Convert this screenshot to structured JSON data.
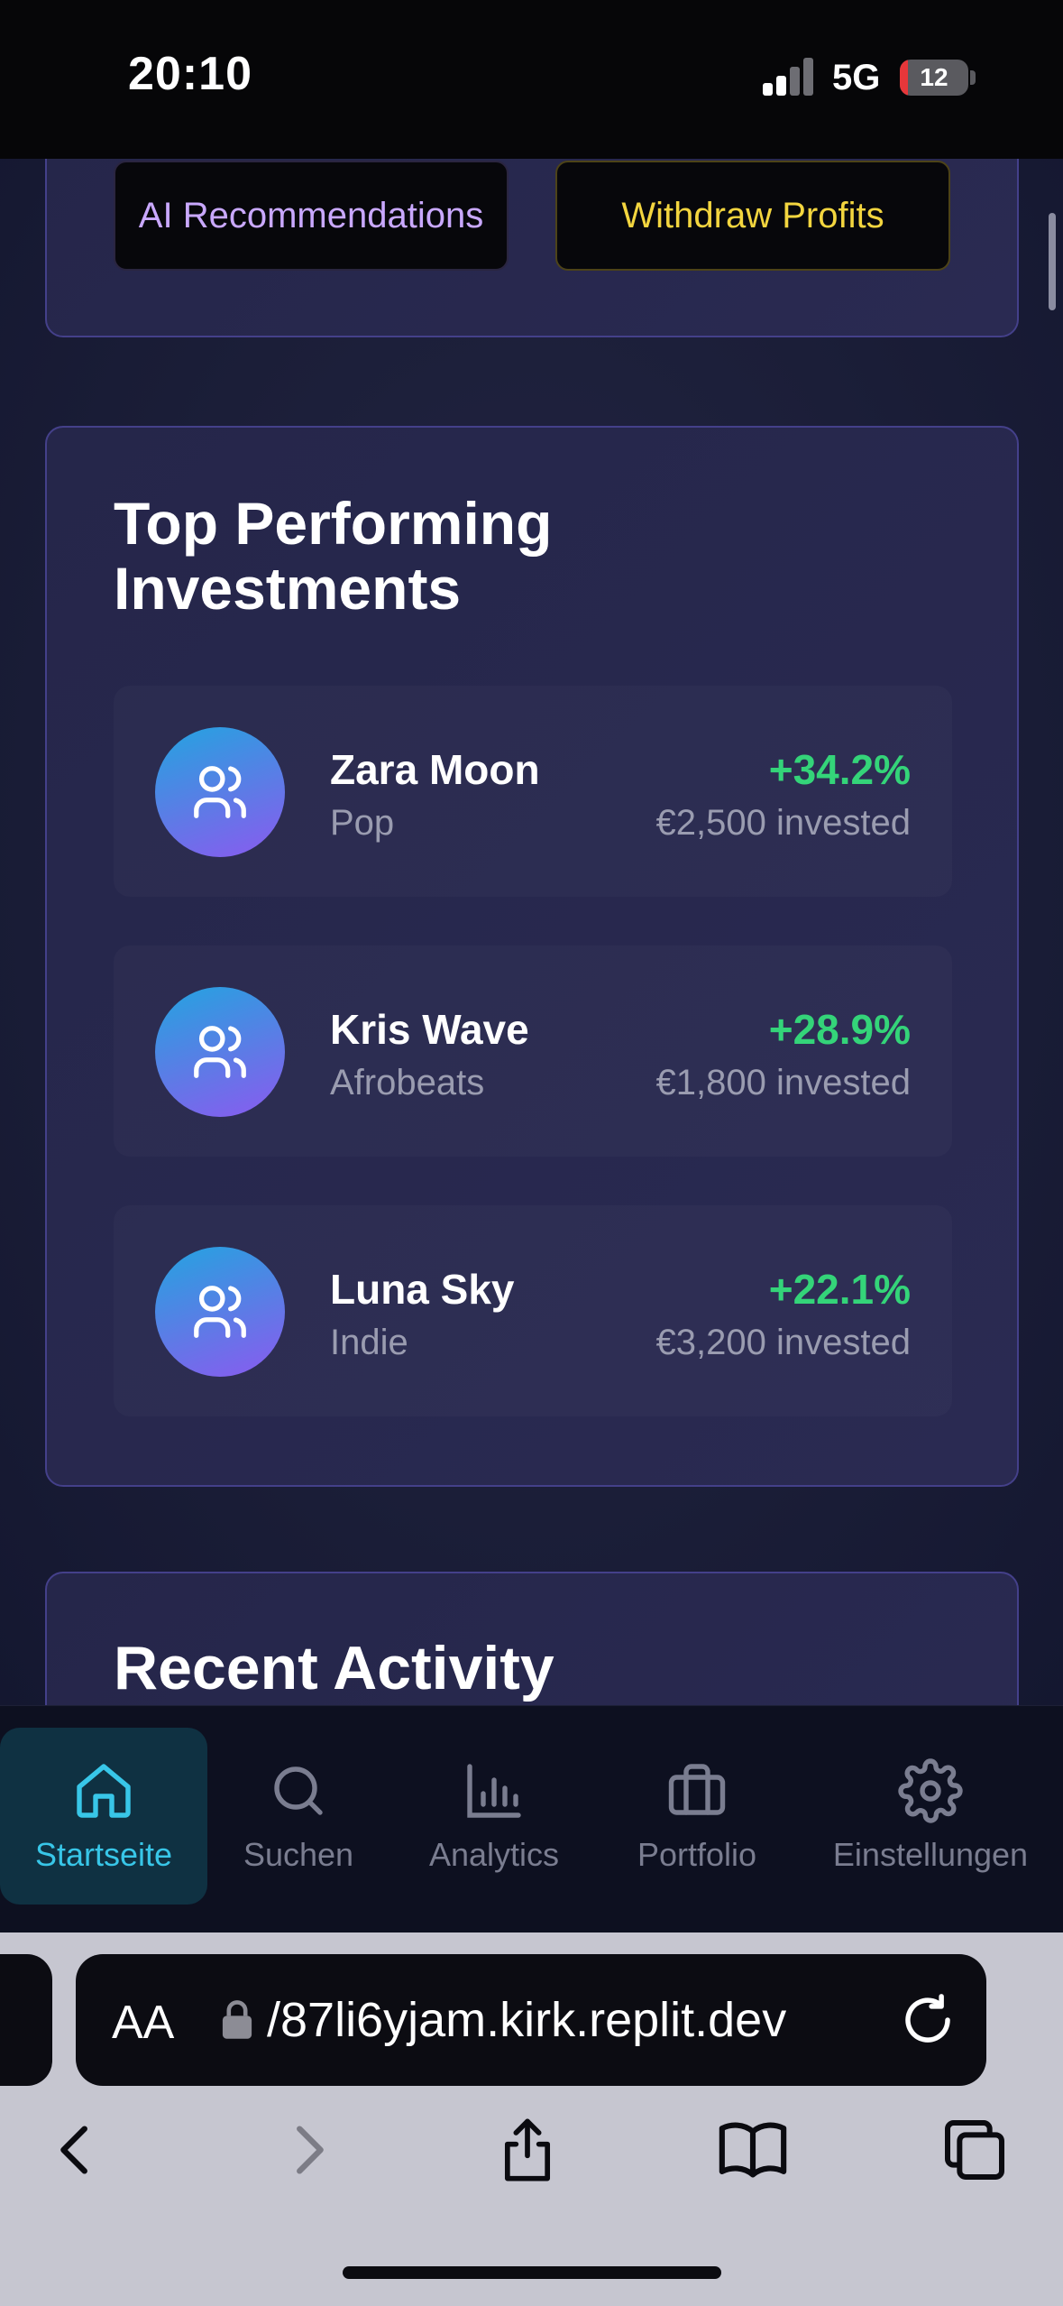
{
  "status_bar": {
    "time": "20:10",
    "network": "5G",
    "battery": "12",
    "battery_level": 0.12
  },
  "top_actions": {
    "ai_label": "AI Recommendations",
    "withdraw_label": "Withdraw Profits"
  },
  "investments": {
    "title": "Top Performing Investments",
    "items": [
      {
        "name": "Zara Moon",
        "genre": "Pop",
        "change": "+34.2%",
        "amount": "€2,500 invested",
        "icon": "users-icon"
      },
      {
        "name": "Kris Wave",
        "genre": "Afrobeats",
        "change": "+28.9%",
        "amount": "€1,800 invested",
        "icon": "users-icon"
      },
      {
        "name": "Luna Sky",
        "genre": "Indie",
        "change": "+22.1%",
        "amount": "€3,200 invested",
        "icon": "users-icon"
      }
    ]
  },
  "activity": {
    "title": "Recent Activity"
  },
  "bottom_nav": {
    "items": [
      {
        "label": "Startseite",
        "icon": "home-icon",
        "active": true
      },
      {
        "label": "Suchen",
        "icon": "search-icon",
        "active": false
      },
      {
        "label": "Analytics",
        "icon": "bar-chart-icon",
        "active": false
      },
      {
        "label": "Portfolio",
        "icon": "briefcase-icon",
        "active": false
      },
      {
        "label": "Einstellungen",
        "icon": "gear-icon",
        "active": false
      }
    ]
  },
  "browser": {
    "aa_label": "AA",
    "url": "/87li6yjam.kirk.replit.dev"
  },
  "colors": {
    "accent": "#38c6e8",
    "positive": "#34d479",
    "ai_button_text": "#c9a8ff",
    "withdraw_button_text": "#f3d53f",
    "card_border": "#44408a"
  }
}
